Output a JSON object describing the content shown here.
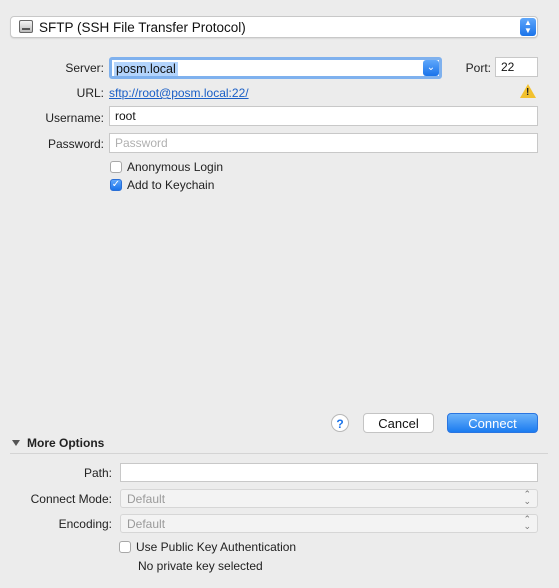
{
  "protocol": {
    "label": "SFTP (SSH File Transfer Protocol)",
    "icon": "drive-icon"
  },
  "server": {
    "label": "Server:",
    "value": "posm.local"
  },
  "port": {
    "label": "Port:",
    "value": "22"
  },
  "url": {
    "label": "URL:",
    "value": "sftp://root@posm.local:22/"
  },
  "username": {
    "label": "Username:",
    "value": "root"
  },
  "password": {
    "label": "Password:",
    "placeholder": "Password",
    "value": ""
  },
  "options": {
    "anonymous": {
      "label": "Anonymous Login",
      "checked": false
    },
    "keychain": {
      "label": "Add to Keychain",
      "checked": true
    }
  },
  "buttons": {
    "help": "?",
    "cancel": "Cancel",
    "connect": "Connect"
  },
  "more_options": {
    "title": "More Options",
    "path": {
      "label": "Path:",
      "value": ""
    },
    "connect_mode": {
      "label": "Connect Mode:",
      "value": "Default"
    },
    "encoding": {
      "label": "Encoding:",
      "value": "Default"
    },
    "public_key": {
      "label": "Use Public Key Authentication",
      "checked": false
    },
    "private_key_status": "No private key selected"
  },
  "colors": {
    "accent": "#1a73ea",
    "link": "#1a5fc7",
    "warning": "#f2c12e"
  }
}
